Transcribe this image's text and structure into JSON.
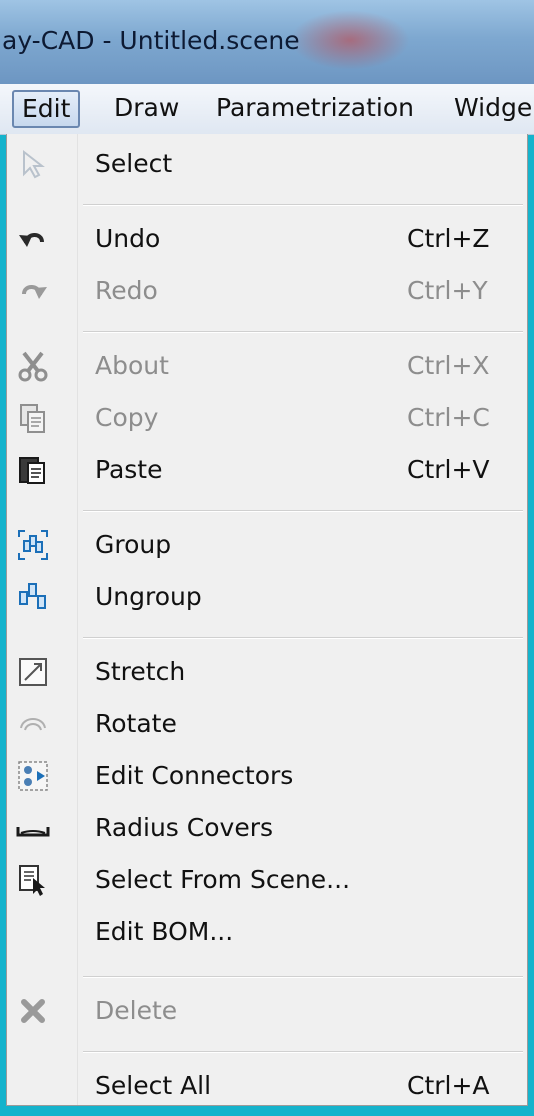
{
  "window": {
    "title": "ay-CAD - Untitled.scene"
  },
  "menubar": {
    "items": [
      {
        "label": "Edit"
      },
      {
        "label": "Draw"
      },
      {
        "label": "Parametrization"
      },
      {
        "label": "Widge"
      }
    ]
  },
  "edit_menu": {
    "items": [
      {
        "label": "Select",
        "shortcut": "",
        "enabled": true,
        "icon": "cursor-arrow-icon"
      },
      {
        "label": "Undo",
        "shortcut": "Ctrl+Z",
        "enabled": true,
        "icon": "undo-icon"
      },
      {
        "label": "Redo",
        "shortcut": "Ctrl+Y",
        "enabled": false,
        "icon": "redo-icon"
      },
      {
        "label": "About",
        "shortcut": "Ctrl+X",
        "enabled": false,
        "icon": "scissors-icon"
      },
      {
        "label": "Copy",
        "shortcut": "Ctrl+C",
        "enabled": false,
        "icon": "copy-icon"
      },
      {
        "label": "Paste",
        "shortcut": "Ctrl+V",
        "enabled": true,
        "icon": "paste-icon"
      },
      {
        "label": "Group",
        "shortcut": "",
        "enabled": true,
        "icon": "group-icon"
      },
      {
        "label": "Ungroup",
        "shortcut": "",
        "enabled": true,
        "icon": "ungroup-icon"
      },
      {
        "label": "Stretch",
        "shortcut": "",
        "enabled": true,
        "icon": "stretch-icon"
      },
      {
        "label": "Rotate",
        "shortcut": "",
        "enabled": true,
        "icon": "rotate-icon"
      },
      {
        "label": "Edit Connectors",
        "shortcut": "",
        "enabled": true,
        "icon": "connectors-icon"
      },
      {
        "label": "Radius Covers",
        "shortcut": "",
        "enabled": true,
        "icon": "radius-cover-icon"
      },
      {
        "label": "Select From Scene...",
        "shortcut": "",
        "enabled": true,
        "icon": "select-from-scene-icon"
      },
      {
        "label": "Edit BOM...",
        "shortcut": "",
        "enabled": true,
        "icon": ""
      },
      {
        "label": "Delete",
        "shortcut": "",
        "enabled": false,
        "icon": "delete-x-icon"
      },
      {
        "label": "Select All",
        "shortcut": "Ctrl+A",
        "enabled": true,
        "icon": ""
      }
    ]
  }
}
